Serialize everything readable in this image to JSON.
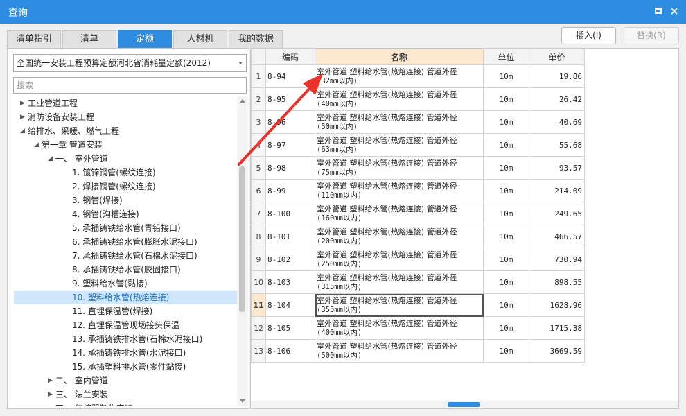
{
  "window": {
    "title": "查询",
    "maximize_glyph": "□",
    "close_glyph": "×"
  },
  "tabs": [
    "清单指引",
    "清单",
    "定额",
    "人材机",
    "我的数据"
  ],
  "toolbar": {
    "insert_label": "插入(I)",
    "replace_label": "替换(R)"
  },
  "left": {
    "combo_value": "全国统一安装工程预算定额河北省消耗量定额(2012)",
    "search_placeholder": "搜索",
    "tree": [
      {
        "label": "工业管道工程",
        "state": "collapsed"
      },
      {
        "label": "消防设备安装工程",
        "state": "collapsed"
      },
      {
        "label": "给排水、采暖、燃气工程",
        "state": "expanded"
      },
      {
        "label": "第一章 管道安装",
        "state": "expanded"
      },
      {
        "label": "一、 室外管道",
        "state": "expanded"
      },
      {
        "label": "1. 镀锌钢管(螺纹连接)"
      },
      {
        "label": "2. 焊接钢管(螺纹连接)"
      },
      {
        "label": "3. 钢管(焊接)"
      },
      {
        "label": "4. 钢管(沟槽连接)"
      },
      {
        "label": "5. 承插铸铁给水管(青铅接口)"
      },
      {
        "label": "6. 承插铸铁给水管(膨胀水泥接口)"
      },
      {
        "label": "7. 承插铸铁给水管(石棉水泥接口)"
      },
      {
        "label": "8. 承插铸铁给水管(胶圈接口)"
      },
      {
        "label": "9. 塑料给水管(黏接)"
      },
      {
        "label": "10. 塑料给水管(热熔连接)",
        "selected": true
      },
      {
        "label": "11. 直埋保温管(焊接)"
      },
      {
        "label": "12. 直埋保温管现场接头保温"
      },
      {
        "label": "13. 承插铸铁排水管(石棉水泥接口)"
      },
      {
        "label": "14. 承插铸铁排水管(水泥接口)"
      },
      {
        "label": "15. 承插塑料排水管(零件黏接)"
      },
      {
        "label": "二、 室内管道",
        "state": "collapsed"
      },
      {
        "label": "三、 法兰安装",
        "state": "collapsed"
      },
      {
        "label": "四、 伸缩器制作安装",
        "state": "collapsed"
      }
    ]
  },
  "grid": {
    "headers": {
      "code": "编码",
      "name": "名称",
      "unit": "单位",
      "price": "单价"
    },
    "current_row": 11,
    "rows": [
      {
        "no": "1",
        "code": "8-94",
        "name": "室外管道 塑料给水管(热熔连接) 管道外径",
        "spec": "(32mm以内)",
        "unit": "10m",
        "price": "19.86"
      },
      {
        "no": "2",
        "code": "8-95",
        "name": "室外管道 塑料给水管(热熔连接) 管道外径",
        "spec": "(40mm以内)",
        "unit": "10m",
        "price": "26.42"
      },
      {
        "no": "3",
        "code": "8-96",
        "name": "室外管道 塑料给水管(热熔连接) 管道外径",
        "spec": "(50mm以内)",
        "unit": "10m",
        "price": "40.69"
      },
      {
        "no": "4",
        "code": "8-97",
        "name": "室外管道 塑料给水管(热熔连接) 管道外径",
        "spec": "(63mm以内)",
        "unit": "10m",
        "price": "55.68"
      },
      {
        "no": "5",
        "code": "8-98",
        "name": "室外管道 塑料给水管(热熔连接) 管道外径",
        "spec": "(75mm以内)",
        "unit": "10m",
        "price": "93.57"
      },
      {
        "no": "6",
        "code": "8-99",
        "name": "室外管道 塑料给水管(热熔连接) 管道外径",
        "spec": "(110mm以内)",
        "unit": "10m",
        "price": "214.09"
      },
      {
        "no": "7",
        "code": "8-100",
        "name": "室外管道 塑料给水管(热熔连接) 管道外径",
        "spec": "(160mm以内)",
        "unit": "10m",
        "price": "249.65"
      },
      {
        "no": "8",
        "code": "8-101",
        "name": "室外管道 塑料给水管(热熔连接) 管道外径",
        "spec": "(200mm以内)",
        "unit": "10m",
        "price": "466.57"
      },
      {
        "no": "9",
        "code": "8-102",
        "name": "室外管道 塑料给水管(热熔连接) 管道外径",
        "spec": "(250mm以内)",
        "unit": "10m",
        "price": "730.94"
      },
      {
        "no": "10",
        "code": "8-103",
        "name": "室外管道 塑料给水管(热熔连接) 管道外径",
        "spec": "(315mm以内)",
        "unit": "10m",
        "price": "898.55"
      },
      {
        "no": "11",
        "code": "8-104",
        "name": "室外管道 塑料给水管(热熔连接) 管道外径",
        "spec": "(355mm以内)",
        "unit": "10m",
        "price": "1628.96"
      },
      {
        "no": "12",
        "code": "8-105",
        "name": "室外管道 塑料给水管(热熔连接) 管道外径",
        "spec": "(400mm以内)",
        "unit": "10m",
        "price": "1715.38"
      },
      {
        "no": "13",
        "code": "8-106",
        "name": "室外管道 塑料给水管(热熔连接) 管道外径",
        "spec": "(500mm以内)",
        "unit": "10m",
        "price": "3669.59"
      }
    ]
  },
  "colors": {
    "accent": "#2e8de0",
    "header_highlight": "#fde9cf",
    "selection": "#cfe6fb",
    "annotation_arrow": "#e8322a"
  }
}
